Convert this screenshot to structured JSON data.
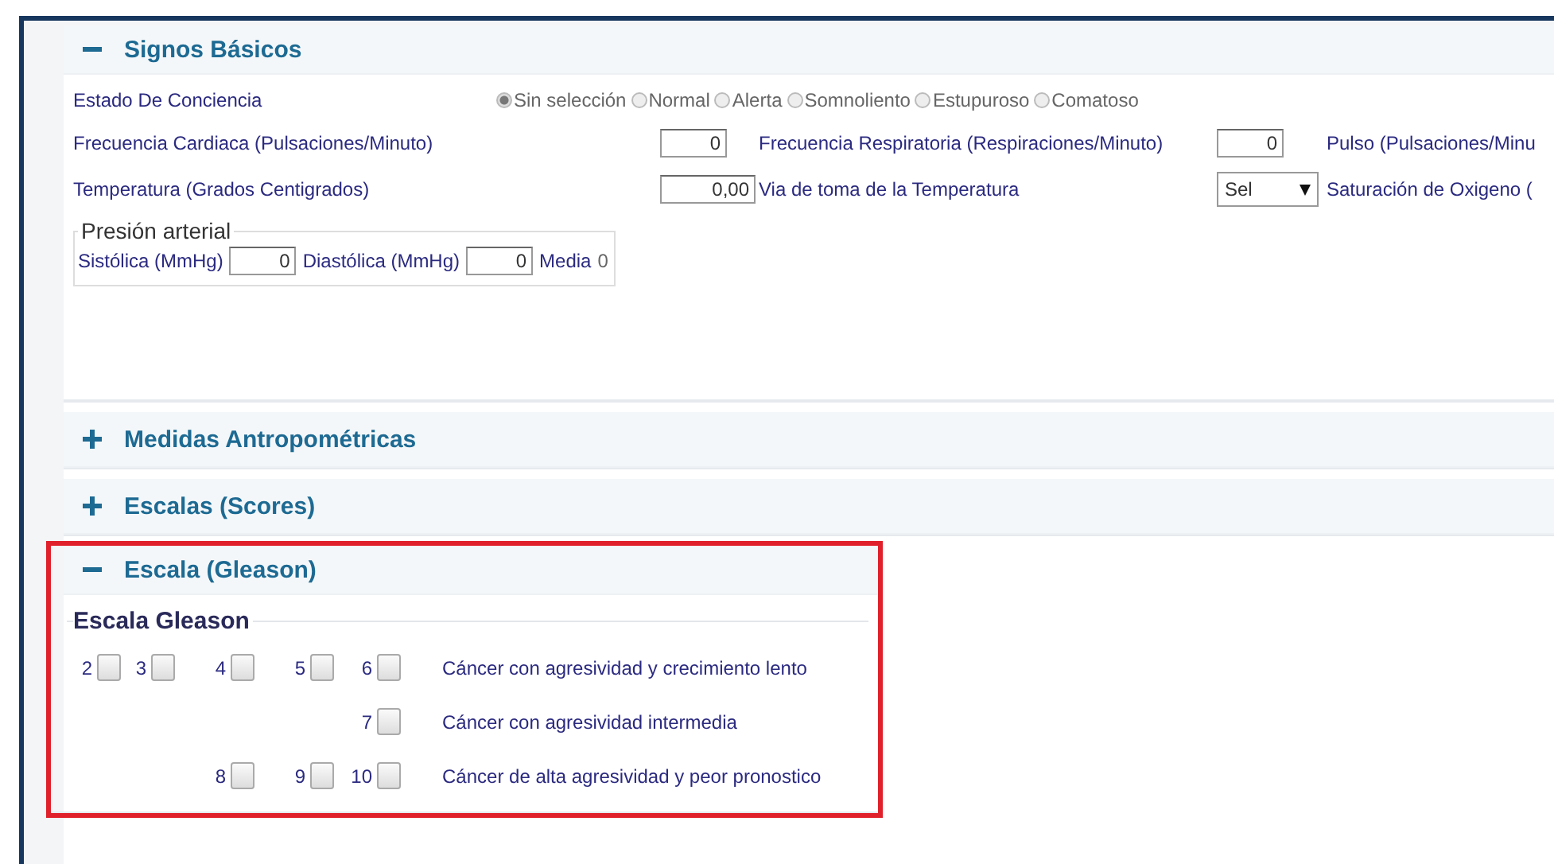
{
  "sections": [
    {
      "kind": "vitals",
      "title": "Signos Básicos",
      "expanded": true,
      "highlighted": false,
      "consciousness": {
        "label": "Estado De Conciencia",
        "options": [
          {
            "label": "Sin selección",
            "selected": true
          },
          {
            "label": "Normal",
            "selected": false
          },
          {
            "label": "Alerta",
            "selected": false
          },
          {
            "label": "Somnoliento",
            "selected": false
          },
          {
            "label": "Estupuroso",
            "selected": false
          },
          {
            "label": "Comatoso",
            "selected": false
          }
        ]
      },
      "rows": [
        [
          {
            "kind": "label",
            "text": "Frecuencia Cardiaca (Pulsaciones/Minuto)"
          },
          {
            "kind": "input",
            "value": "0"
          },
          {
            "kind": "label",
            "text": "Frecuencia Respiratoria (Respiraciones/Minuto)"
          },
          {
            "kind": "input",
            "value": "0"
          },
          {
            "kind": "label",
            "text": "Pulso (Pulsaciones/Minu"
          }
        ],
        [
          {
            "kind": "label",
            "text": "Temperatura (Grados Centigrados)"
          },
          {
            "kind": "input",
            "value": "0,00"
          },
          {
            "kind": "label",
            "text": "Via de toma de la Temperatura"
          },
          {
            "kind": "select",
            "value": "Sel"
          },
          {
            "kind": "label",
            "text": "Saturación de Oxigeno ("
          }
        ]
      ],
      "blood_pressure": {
        "legend": "Presión arterial",
        "fields": [
          {
            "label": "Sistólica (MmHg)",
            "value": "0"
          },
          {
            "label": "Diastólica (MmHg)",
            "value": "0"
          }
        ],
        "mean_label": "Media",
        "mean_value": "0"
      }
    },
    {
      "title": "Medidas Antropométricas",
      "expanded": false,
      "highlighted": false
    },
    {
      "title": "Escalas (Scores)",
      "expanded": false,
      "highlighted": false
    },
    {
      "kind": "gleason",
      "title": "Escala (Gleason)",
      "expanded": true,
      "highlighted": true,
      "legend": "Escala Gleason",
      "rows": [
        {
          "scores": [
            {
              "label": "2",
              "checked": false
            },
            {
              "label": "3",
              "checked": false
            },
            {
              "label": "4",
              "checked": false
            },
            {
              "label": "5",
              "checked": false
            },
            {
              "label": "6",
              "checked": false
            }
          ],
          "description": "Cáncer con agresividad y crecimiento lento"
        },
        {
          "scores": [
            {
              "label": "7",
              "checked": false
            }
          ],
          "description": "Cáncer con agresividad intermedia"
        },
        {
          "scores": [
            {
              "label": "8",
              "checked": false
            },
            {
              "label": "9",
              "checked": false
            },
            {
              "label": "10",
              "checked": false
            }
          ],
          "description": "Cáncer de alta agresividad y peor pronostico"
        }
      ]
    }
  ]
}
